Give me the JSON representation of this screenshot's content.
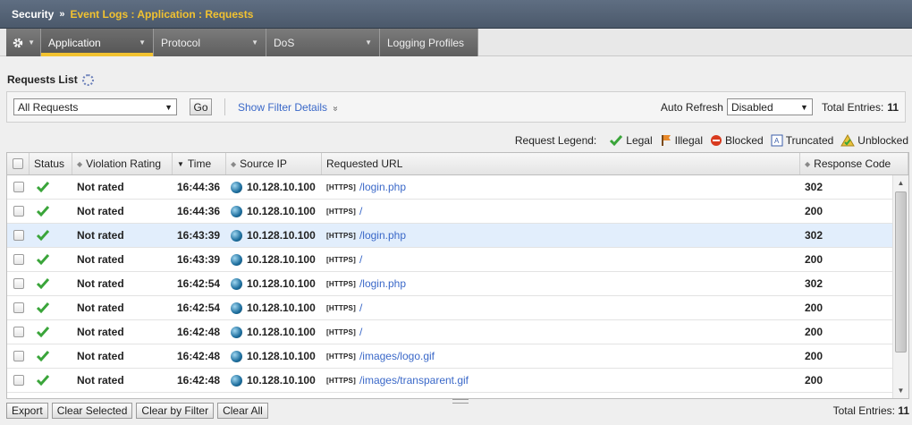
{
  "breadcrumb": {
    "root": "Security",
    "separator": "»",
    "path": "Event Logs : Application : Requests"
  },
  "tabs": [
    {
      "label": "Application",
      "caret": "▼"
    },
    {
      "label": "Protocol",
      "caret": "▼"
    },
    {
      "label": "DoS",
      "caret": "▼"
    },
    {
      "label": "Logging Profiles"
    }
  ],
  "gear_tab": {
    "icon": "gear-icon",
    "caret": "▼"
  },
  "page_title": "Requests List",
  "filter": {
    "select_value": "All Requests",
    "go_label": "Go",
    "details_link": "Show Filter Details",
    "details_icon": "»",
    "auto_refresh_label": "Auto Refresh",
    "auto_refresh_value": "Disabled",
    "total_label": "Total Entries:",
    "total_value": "11"
  },
  "legend": {
    "label": "Request Legend:",
    "items": [
      {
        "label": "Legal",
        "icon": "legal-check-icon",
        "color": "#3aa53a"
      },
      {
        "label": "Illegal",
        "icon": "illegal-flag-icon",
        "color": "#e8892a"
      },
      {
        "label": "Blocked",
        "icon": "blocked-icon",
        "color": "#d83a1e"
      },
      {
        "label": "Truncated",
        "icon": "truncated-icon",
        "color": "#3b5ea8"
      },
      {
        "label": "Unblocked",
        "icon": "unblocked-icon",
        "color": "#e9c23a"
      }
    ]
  },
  "columns": {
    "status": "Status",
    "rating": "Violation Rating",
    "time": "Time",
    "ip": "Source IP",
    "url": "Requested URL",
    "code": "Response Code"
  },
  "rows": [
    {
      "rating": "Not rated",
      "time": "16:44:36",
      "ip": "10.128.10.100",
      "scheme": "[HTTPS]",
      "url": "/login.php",
      "code": "302"
    },
    {
      "rating": "Not rated",
      "time": "16:44:36",
      "ip": "10.128.10.100",
      "scheme": "[HTTPS]",
      "url": "/",
      "code": "200"
    },
    {
      "rating": "Not rated",
      "time": "16:43:39",
      "ip": "10.128.10.100",
      "scheme": "[HTTPS]",
      "url": "/login.php",
      "code": "302"
    },
    {
      "rating": "Not rated",
      "time": "16:43:39",
      "ip": "10.128.10.100",
      "scheme": "[HTTPS]",
      "url": "/",
      "code": "200"
    },
    {
      "rating": "Not rated",
      "time": "16:42:54",
      "ip": "10.128.10.100",
      "scheme": "[HTTPS]",
      "url": "/login.php",
      "code": "302"
    },
    {
      "rating": "Not rated",
      "time": "16:42:54",
      "ip": "10.128.10.100",
      "scheme": "[HTTPS]",
      "url": "/",
      "code": "200"
    },
    {
      "rating": "Not rated",
      "time": "16:42:48",
      "ip": "10.128.10.100",
      "scheme": "[HTTPS]",
      "url": "/",
      "code": "200"
    },
    {
      "rating": "Not rated",
      "time": "16:42:48",
      "ip": "10.128.10.100",
      "scheme": "[HTTPS]",
      "url": "/images/logo.gif",
      "code": "200"
    },
    {
      "rating": "Not rated",
      "time": "16:42:48",
      "ip": "10.128.10.100",
      "scheme": "[HTTPS]",
      "url": "/images/transparent.gif",
      "code": "200"
    }
  ],
  "selected_row": 2,
  "footer": {
    "export": "Export",
    "clear_selected": "Clear Selected",
    "clear_filter": "Clear by Filter",
    "clear_all": "Clear All",
    "total_label": "Total Entries:",
    "total_value": "11"
  }
}
